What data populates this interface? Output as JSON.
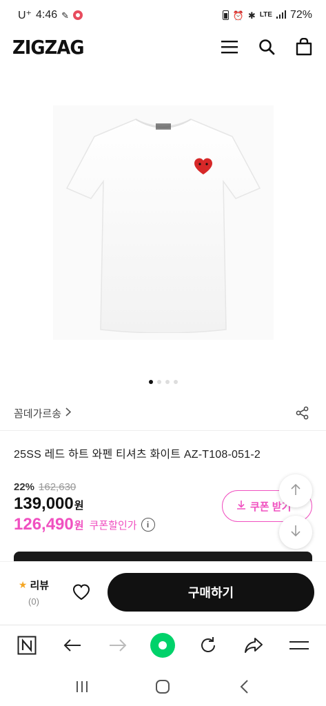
{
  "status_bar": {
    "carrier": "U⁺",
    "time": "4:46",
    "network": "LTE",
    "battery": "72%"
  },
  "header": {
    "logo": "ZIGZAG",
    "icons": [
      "menu-icon",
      "search-icon",
      "shopping-bag-icon"
    ]
  },
  "gallery": {
    "image_count": 4,
    "active_index": 0
  },
  "brand": {
    "name": "꼼데가르송",
    "chevron": "›"
  },
  "product": {
    "title": "25SS 레드 하트 와펜 티셔츠 화이트 AZ-T108-051-2"
  },
  "price": {
    "discount_pct": "22%",
    "original": "162,630",
    "sale": "139,000",
    "won": "원",
    "coupon_price": "126,490",
    "coupon_label": "쿠폰할인가",
    "info_icon": "i"
  },
  "coupon_button": {
    "label": "쿠폰 받기"
  },
  "bottom_bar": {
    "review_label": "리뷰",
    "review_count": "(0)",
    "buy_label": "구매하기"
  },
  "colors": {
    "accent_pink": "#f050c0",
    "naver_green": "#00d26a",
    "buy_button": "#111111"
  }
}
